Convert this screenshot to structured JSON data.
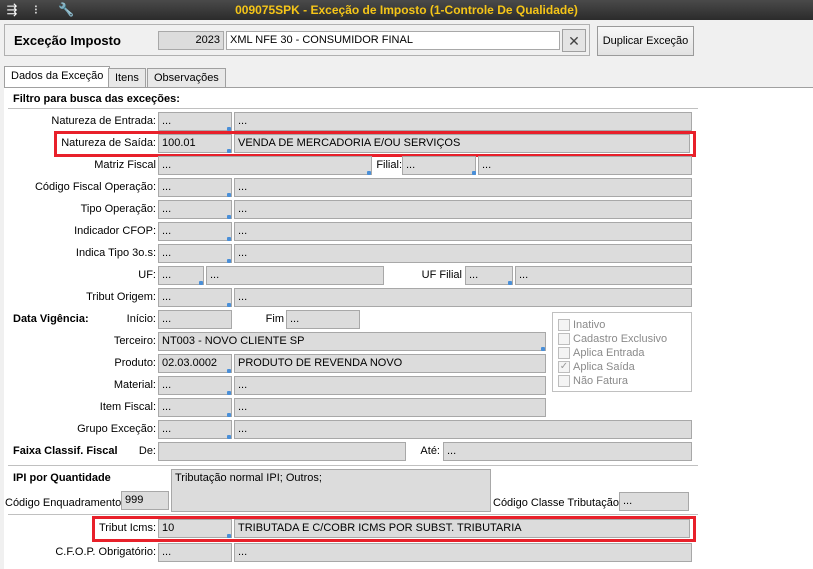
{
  "window": {
    "title": "009075SPK - Exceção de Imposto (1-Controle De Qualidade)"
  },
  "header": {
    "label": "Exceção Imposto",
    "year": "2023",
    "description": "XML NFE 30 - CONSUMIDOR FINAL",
    "clear_button": "✕",
    "duplicate_button": "Duplicar Exceção"
  },
  "tabs": [
    "Dados da Exceção",
    "Itens",
    "Observações"
  ],
  "filter_section": "Filtro para busca das exceções:",
  "fields": {
    "natureza_entrada": {
      "label": "Natureza de Entrada:",
      "code": "...",
      "desc": "..."
    },
    "natureza_saida": {
      "label": "Natureza de Saída:",
      "code": "100.01",
      "desc": "VENDA DE MERCADORIA E/OU SERVIÇOS"
    },
    "matriz_fiscal": {
      "label": "Matriz Fiscal",
      "code": "...",
      "filial_label": "Filial:",
      "filial_code": "...",
      "filial_desc": "..."
    },
    "codigo_fiscal": {
      "label": "Código Fiscal Operação:",
      "code": "...",
      "desc": "..."
    },
    "tipo_operacao": {
      "label": "Tipo Operação:",
      "code": "...",
      "desc": "..."
    },
    "indicador_cfop": {
      "label": "Indicador CFOP:",
      "code": "...",
      "desc": "..."
    },
    "indica_tipo": {
      "label": "Indica Tipo 3o.s:",
      "code": "...",
      "desc": "..."
    },
    "uf": {
      "label": "UF:",
      "code": "...",
      "desc": "...",
      "filial_label": "UF Filial",
      "filial_code": "...",
      "filial_desc": "..."
    },
    "tribut_origem": {
      "label": "Tribut Origem:",
      "code": "...",
      "desc": "..."
    }
  },
  "vigencia": {
    "section": "Data Vigência:",
    "inicio_label": "Início:",
    "inicio": "...",
    "fim_label": "Fim",
    "fim": "..."
  },
  "terceiro": {
    "label": "Terceiro:",
    "value": "NT003 - NOVO CLIENTE SP"
  },
  "produto": {
    "label": "Produto:",
    "code": "02.03.0002",
    "desc": "PRODUTO DE REVENDA NOVO"
  },
  "material": {
    "label": "Material:",
    "code": "...",
    "desc": "..."
  },
  "item_fiscal": {
    "label": "Item Fiscal:",
    "code": "...",
    "desc": "..."
  },
  "grupo_excecao": {
    "label": "Grupo Exceção:",
    "code": "...",
    "desc": "..."
  },
  "checkboxes": [
    {
      "label": "Inativo",
      "checked": false
    },
    {
      "label": "Cadastro Exclusivo",
      "checked": false
    },
    {
      "label": "Aplica Entrada",
      "checked": false
    },
    {
      "label": "Aplica Saída",
      "checked": true
    },
    {
      "label": "Não Fatura",
      "checked": false
    }
  ],
  "faixa": {
    "section": "Faixa Classif. Fiscal",
    "de_label": "De:",
    "de": "",
    "ate_label": "Até:",
    "ate": "..."
  },
  "ipi": {
    "section": "IPI por Quantidade",
    "tributacao": "Tributação normal IPI; Outros;",
    "enq_label": "Código Enquadramento",
    "enq": "999",
    "classe_label": "Código Classe Tributação",
    "classe": "..."
  },
  "tribut_icms": {
    "label": "Tribut Icms:",
    "code": "10",
    "desc": "TRIBUTADA E C/COBR ICMS POR SUBST. TRIBUTARIA"
  },
  "cfop_obrig": {
    "label": "C.F.O.P. Obrigatório:",
    "code": "...",
    "desc": "..."
  }
}
